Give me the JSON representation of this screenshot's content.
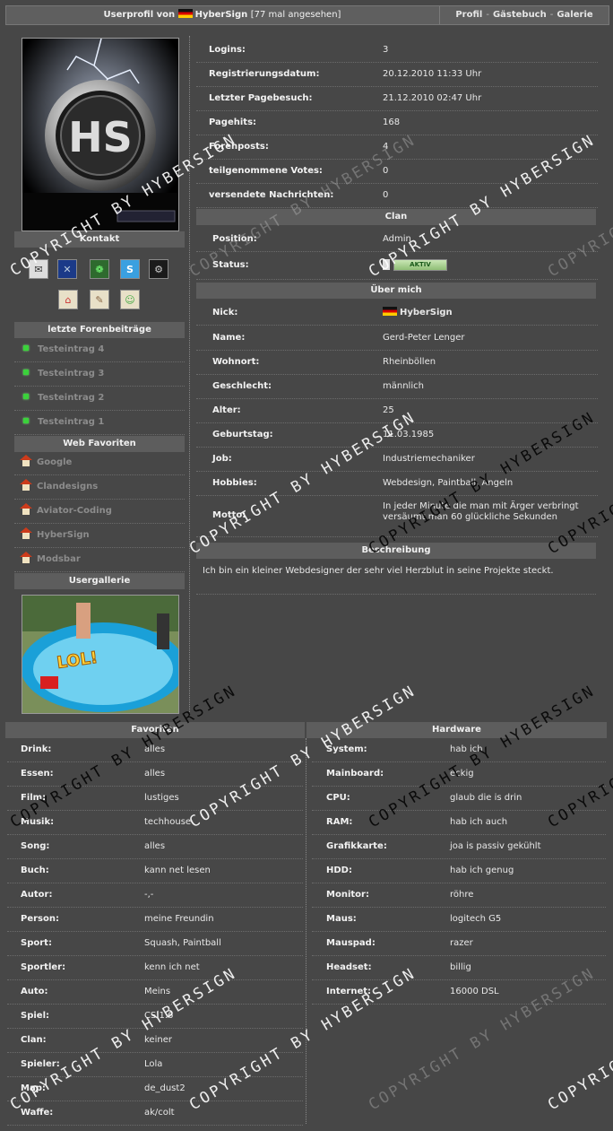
{
  "header": {
    "title_prefix": "Userprofil von",
    "username": "HyberSign",
    "views": "[77 mal angesehen]",
    "nav": [
      "Profil",
      "Gästebuch",
      "Galerie"
    ],
    "nav_sep": "-"
  },
  "sidebar": {
    "contact_title": "Kontakt",
    "contact_icons": [
      "mail-icon",
      "xfire-icon",
      "icq-icon",
      "skype-icon",
      "steam-icon",
      "homepage-icon",
      "guestbook-icon",
      "add-buddy-icon"
    ],
    "forum_title": "letzte Forenbeiträge",
    "forum_posts": [
      "Testeintrag 4",
      "Testeintrag 3",
      "Testeintrag 2",
      "Testeintrag 1"
    ],
    "favorites_title": "Web Favoriten",
    "web_favorites": [
      "Google",
      "Clandesigns",
      "Aviator-Coding",
      "HyberSign",
      "Modsbar"
    ],
    "gallery_title": "Usergallerie",
    "gallery_text": "LOL!"
  },
  "stats": [
    {
      "k": "Logins:",
      "v": "3"
    },
    {
      "k": "Registrierungsdatum:",
      "v": "20.12.2010 11:33 Uhr"
    },
    {
      "k": "Letzter Pagebesuch:",
      "v": "21.12.2010 02:47 Uhr"
    },
    {
      "k": "Pagehits:",
      "v": "168"
    },
    {
      "k": "Forenposts:",
      "v": "4"
    },
    {
      "k": "teilgenommene Votes:",
      "v": "0"
    },
    {
      "k": "versendete Nachrichten:",
      "v": "0"
    }
  ],
  "clan": {
    "title": "Clan",
    "position_label": "Position:",
    "position_value": "Admin",
    "status_label": "Status:",
    "status_badge": "AKTIV"
  },
  "about": {
    "title": "Über mich",
    "rows": [
      {
        "k": "Nick:",
        "v": "HyberSign"
      },
      {
        "k": "Name:",
        "v": "Gerd-Peter Lenger"
      },
      {
        "k": "Wohnort:",
        "v": "Rheinböllen"
      },
      {
        "k": "Geschlecht:",
        "v": "männlich"
      },
      {
        "k": "Alter:",
        "v": "25"
      },
      {
        "k": "Geburtstag:",
        "v": "11.03.1985"
      },
      {
        "k": "Job:",
        "v": "Industriemechaniker"
      },
      {
        "k": "Hobbies:",
        "v": "Webdesign, Paintball, Angeln"
      },
      {
        "k": "Motto:",
        "v": "In jeder Minute die man mit Ärger verbringt versäumt man 60 glückliche Sekunden"
      }
    ],
    "desc_title": "Beschreibung",
    "description": "Ich bin ein kleiner Webdesigner der sehr viel Herzblut in seine Projekte steckt."
  },
  "favorites": {
    "title": "Favoriten",
    "rows": [
      {
        "k": "Drink:",
        "v": "alles"
      },
      {
        "k": "Essen:",
        "v": "alles"
      },
      {
        "k": "Film:",
        "v": "lustiges"
      },
      {
        "k": "Musik:",
        "v": "techhouse"
      },
      {
        "k": "Song:",
        "v": "alles"
      },
      {
        "k": "Buch:",
        "v": "kann net lesen"
      },
      {
        "k": "Autor:",
        "v": "-,-"
      },
      {
        "k": "Person:",
        "v": "meine Freundin"
      },
      {
        "k": "Sport:",
        "v": "Squash, Paintball"
      },
      {
        "k": "Sportler:",
        "v": "kenn ich net"
      },
      {
        "k": "Auto:",
        "v": "Meins"
      },
      {
        "k": "Spiel:",
        "v": "CS 1.6"
      },
      {
        "k": "Clan:",
        "v": "keiner"
      },
      {
        "k": "Spieler:",
        "v": "Lola"
      },
      {
        "k": "Map:",
        "v": "de_dust2"
      },
      {
        "k": "Waffe:",
        "v": "ak/colt"
      }
    ]
  },
  "hardware": {
    "title": "Hardware",
    "rows": [
      {
        "k": "System:",
        "v": "hab ich"
      },
      {
        "k": "Mainboard:",
        "v": "eckig"
      },
      {
        "k": "CPU:",
        "v": "glaub die is drin"
      },
      {
        "k": "RAM:",
        "v": "hab ich auch"
      },
      {
        "k": "Grafikkarte:",
        "v": "joa is passiv gekühlt"
      },
      {
        "k": "HDD:",
        "v": "hab ich genug"
      },
      {
        "k": "Monitor:",
        "v": "röhre"
      },
      {
        "k": "Maus:",
        "v": "logitech G5"
      },
      {
        "k": "Mauspad:",
        "v": "razer"
      },
      {
        "k": "Headset:",
        "v": "billig"
      },
      {
        "k": "Internet:",
        "v": "16000 DSL"
      }
    ]
  },
  "watermark": "COPYRIGHT BY HYBERSIGN",
  "colors": {
    "page_bg": "#474747",
    "header_bg": "#5d5d5d",
    "status_green": "#3bd23b",
    "flag": [
      "#111111",
      "#d80000",
      "#ffcc00"
    ]
  }
}
